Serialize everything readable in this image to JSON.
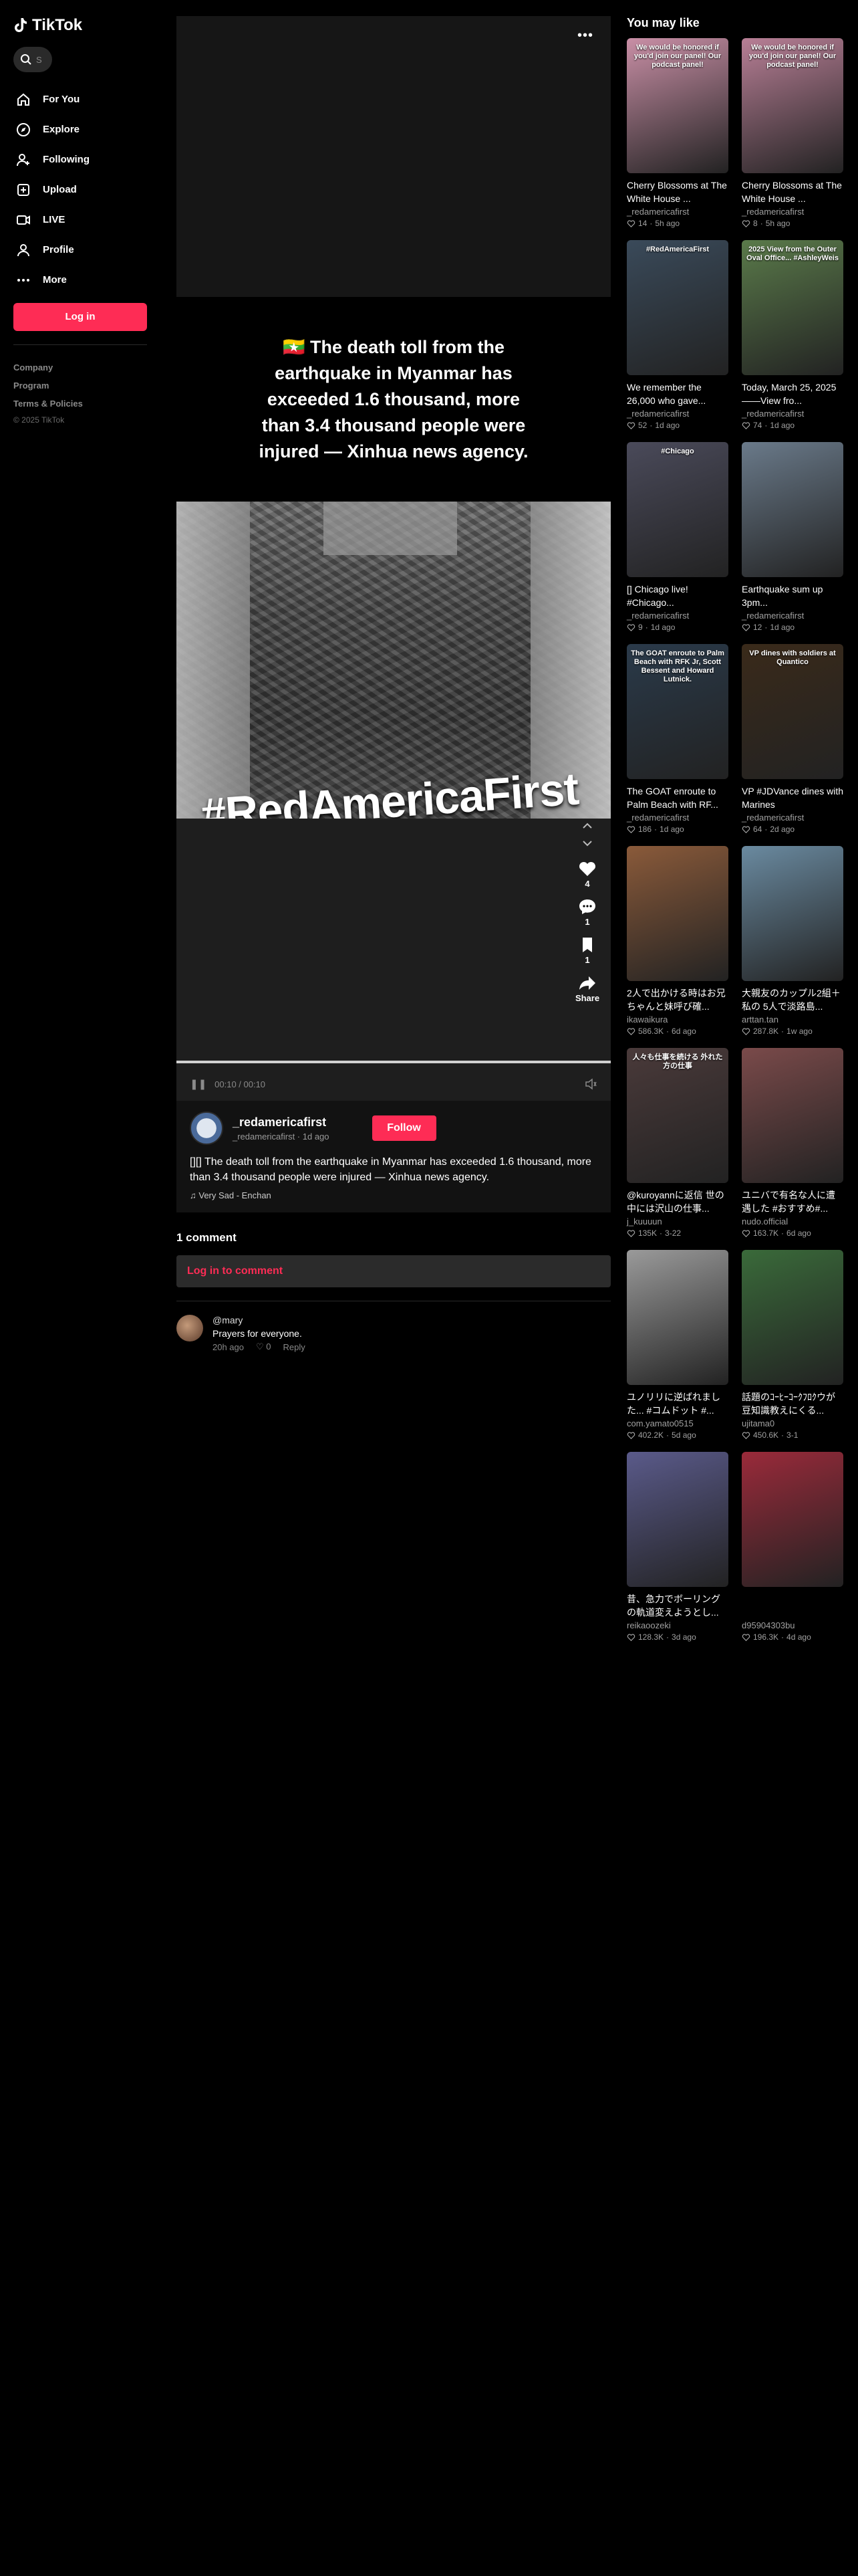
{
  "app": {
    "name": "TikTok"
  },
  "search": {
    "placeholder": "S"
  },
  "nav": [
    {
      "label": "For You",
      "icon": "home-icon"
    },
    {
      "label": "Explore",
      "icon": "compass-icon"
    },
    {
      "label": "Following",
      "icon": "following-icon"
    },
    {
      "label": "Upload",
      "icon": "upload-icon"
    },
    {
      "label": "LIVE",
      "icon": "live-icon"
    },
    {
      "label": "Profile",
      "icon": "profile-icon"
    },
    {
      "label": "More",
      "icon": "more-icon"
    }
  ],
  "login_label": "Log in",
  "footer": {
    "company": "Company",
    "program": "Program",
    "terms": "Terms & Policies",
    "copyright": "© 2025 TikTok"
  },
  "video": {
    "caption": "🇲🇲 The death toll from the earthquake in Myanmar has exceeded 1.6 thousand, more than 3.4 thousand people were injured — Xinhua news agency.",
    "hashtag_overlay": "#RedAmericaFirst",
    "likes": "4",
    "comments": "1",
    "saves": "1",
    "share_label": "Share",
    "time": "00:10 / 00:10",
    "progress": 1.0
  },
  "author": {
    "name": "_redamericafirst",
    "handle_date": "_redamericafirst · 1d ago",
    "follow_label": "Follow"
  },
  "description": "[][] The death toll from the earthquake in Myanmar has exceeded 1.6 thousand, more than 3.4 thousand people were injured — Xinhua news agency.",
  "music": "Very Sad - Enchan",
  "comments_section": {
    "count_label": "1 comment",
    "login_prompt": "Log in to comment",
    "items": [
      {
        "user": "@mary",
        "text": "Prayers for everyone.",
        "time": "20h ago",
        "likes": "0",
        "reply_label": "Reply"
      }
    ]
  },
  "recommend": {
    "heading": "You may like",
    "items": [
      {
        "title": "Cherry Blossoms at The White House ...",
        "author": "_redamericafirst",
        "likes": "14",
        "age": "5h ago",
        "overlay": "We would be honored if you'd join our panel! Our podcast panel!",
        "bg": "#c98fa6"
      },
      {
        "title": "Cherry Blossoms at The White House ...",
        "author": "_redamericafirst",
        "likes": "8",
        "age": "5h ago",
        "overlay": "We would be honored if you'd join our panel! Our podcast panel!",
        "bg": "#b87f96"
      },
      {
        "title": "We remember the 26,000 who gave...",
        "author": "_redamericafirst",
        "likes": "52",
        "age": "1d ago",
        "overlay": "#RedAmericaFirst",
        "bg": "#3a4a5a"
      },
      {
        "title": "Today, March 25, 2025——View fro...",
        "author": "_redamericafirst",
        "likes": "74",
        "age": "1d ago",
        "overlay": "2025 View from the Outer Oval Office... #AshleyWeis",
        "bg": "#5a7a4a"
      },
      {
        "title": "[] Chicago live! #Chicago...",
        "author": "_redamericafirst",
        "likes": "9",
        "age": "1d ago",
        "overlay": "#Chicago",
        "bg": "#4a4a5a"
      },
      {
        "title": "Earthquake sum up 3pm...",
        "author": "_redamericafirst",
        "likes": "12",
        "age": "1d ago",
        "overlay": "",
        "bg": "#6a7a8a"
      },
      {
        "title": "The GOAT enroute to Palm Beach with RF...",
        "author": "_redamericafirst",
        "likes": "186",
        "age": "1d ago",
        "overlay": "The GOAT enroute to Palm Beach with RFK Jr, Scott Bessent and Howard Lutnick.",
        "bg": "#2a3a4a"
      },
      {
        "title": "VP #JDVance dines with Marines",
        "author": "_redamericafirst",
        "likes": "64",
        "age": "2d ago",
        "overlay": "VP dines with soldiers at Quantico",
        "bg": "#3a2a1a"
      },
      {
        "title": "2人で出かける時はお兄ちゃんと妹呼び確...",
        "author": "ikawaikura",
        "likes": "586.3K",
        "age": "6d ago",
        "overlay": "",
        "bg": "#8a5a3a"
      },
      {
        "title": "大親友のカップル2組＋私の 5人で淡路島...",
        "author": "arttan.tan",
        "likes": "287.8K",
        "age": "1w ago",
        "overlay": "",
        "bg": "#6a8aa0"
      },
      {
        "title": "@kuroyannに返信 世の中には沢山の仕事...",
        "author": "j_kuuuun",
        "likes": "135K",
        "age": "3-22",
        "overlay": "人々も仕事を続ける 外れた方の仕事",
        "bg": "#4a3a3a"
      },
      {
        "title": "ユニバで有名な人に遭遇した #おすすめ#...",
        "author": "nudo.official",
        "likes": "163.7K",
        "age": "6d ago",
        "overlay": "",
        "bg": "#7a4a4a"
      },
      {
        "title": "ユノリリに逆ばれまし た... #コムドット #...",
        "author": "com.yamato0515",
        "likes": "402.2K",
        "age": "5d ago",
        "overlay": "",
        "bg": "#9a9a9a"
      },
      {
        "title": "話題のｺｰﾋｰｺｰｸﾌﾛｸウが豆知識教えにくる...",
        "author": "ujitama0",
        "likes": "450.6K",
        "age": "3-1",
        "overlay": "",
        "bg": "#3a6a3a"
      },
      {
        "title": "昔、急力でボーリングの軌道変えようとし...",
        "author": "reikaoozeki",
        "likes": "128.3K",
        "age": "3d ago",
        "overlay": "",
        "bg": "#5a5a8a"
      },
      {
        "title": "",
        "author": "d95904303bu",
        "likes": "196.3K",
        "age": "4d ago",
        "overlay": "",
        "bg": "#9a2a3a"
      }
    ]
  },
  "colors": {
    "accent": "#fe2c55",
    "background": "#000000"
  }
}
